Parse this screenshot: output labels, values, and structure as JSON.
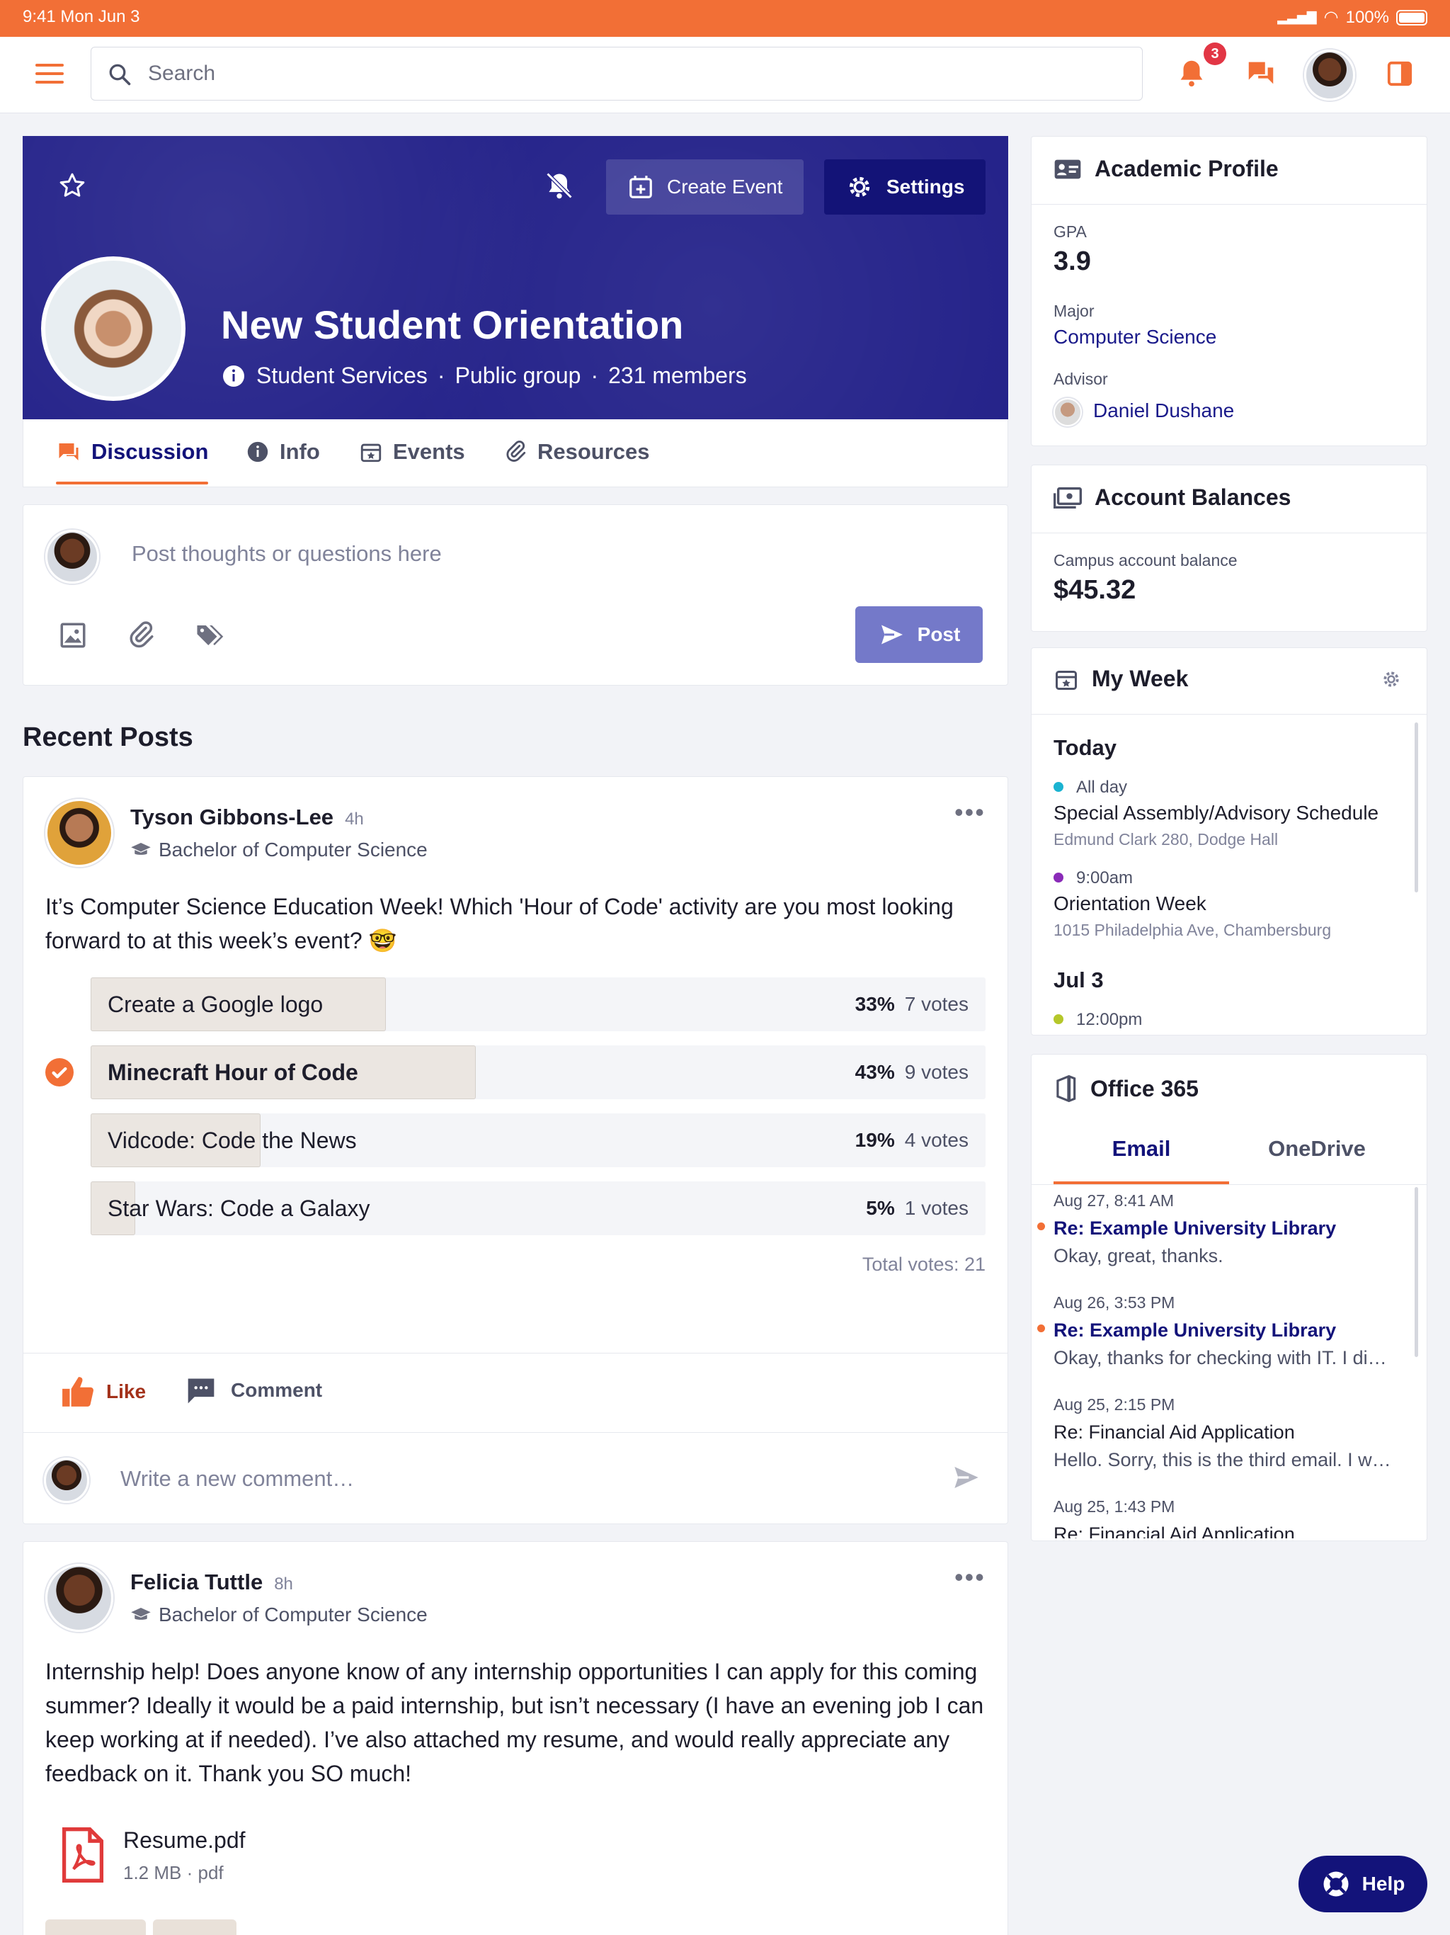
{
  "status": {
    "time": "9:41  Mon Jun 3",
    "battery": "100%"
  },
  "topbar": {
    "search_placeholder": "Search",
    "notification_count": "3"
  },
  "group": {
    "title": "New Student Orientation",
    "org": "Student Services",
    "privacy": "Public group",
    "members": "231 members",
    "create_event": "Create Event",
    "settings": "Settings"
  },
  "tabs": [
    "Discussion",
    "Info",
    "Events",
    "Resources"
  ],
  "composer": {
    "placeholder": "Post thoughts or questions here",
    "post_label": "Post"
  },
  "recent_posts_title": "Recent Posts",
  "post1": {
    "author": "Tyson Gibbons-Lee",
    "time": "4h",
    "program": "Bachelor of Computer Science",
    "body": "It’s Computer Science Education Week! Which 'Hour of Code' activity are you most looking forward to at this week’s event? 🤓",
    "poll": [
      {
        "label": "Create a Google logo",
        "percent": "33%",
        "votes": "7 votes",
        "fraction": 0.33,
        "selected": false
      },
      {
        "label": "Minecraft Hour of Code",
        "percent": "43%",
        "votes": "9 votes",
        "fraction": 0.43,
        "selected": true
      },
      {
        "label": "Vidcode: Code the News",
        "percent": "19%",
        "votes": "4 votes",
        "fraction": 0.19,
        "selected": false
      },
      {
        "label": "Star Wars: Code a Galaxy",
        "percent": "5%",
        "votes": "1 votes",
        "fraction": 0.05,
        "selected": false
      }
    ],
    "total_votes": "Total votes: 21",
    "like": "Like",
    "comment": "Comment",
    "comment_placeholder": "Write a new comment…"
  },
  "post2": {
    "author": "Felicia Tuttle",
    "time": "8h",
    "program": "Bachelor of Computer Science",
    "body": "Internship help! Does anyone know of any internship opportunities I can apply for this coming summer? Ideally it would be a paid internship, but isn’t necessary (I have an evening job I can keep working at if needed). I’ve also attached my resume, and would really appreciate any feedback on it. Thank you SO much!",
    "file_name": "Resume.pdf",
    "file_size": "1.2 MB",
    "file_type": "pdf"
  },
  "academic": {
    "title": "Academic Profile",
    "gpa_label": "GPA",
    "gpa": "3.9",
    "major_label": "Major",
    "major": "Computer Science",
    "advisor_label": "Advisor",
    "advisor": "Daniel Dushane"
  },
  "balances": {
    "title": "Account Balances",
    "label": "Campus account balance",
    "amount": "$45.32"
  },
  "week": {
    "title": "My Week",
    "today": "Today",
    "events": [
      {
        "time": "All day",
        "title": "Special Assembly/Advisory Schedule",
        "location": "Edmund Clark 280, Dodge Hall",
        "color": "#1bb3d1"
      },
      {
        "time": "9:00am",
        "title": "Orientation Week",
        "location": "1015 Philadelphia Ave, Chambersburg",
        "color": "#8a2bb8"
      }
    ],
    "next_day": "Jul 3",
    "next_event": {
      "time": "12:00pm",
      "color": "#b5c72a"
    }
  },
  "office": {
    "title": "Office 365",
    "tab_email": "Email",
    "tab_onedrive": "OneDrive",
    "emails": [
      {
        "date": "Aug 27, 8:41 AM",
        "subject": "Re: Example University Library",
        "preview": "Okay, great, thanks.",
        "unread": true
      },
      {
        "date": "Aug 26, 3:53 PM",
        "subject": "Re: Example University Library",
        "preview": "Okay, thanks for checking with IT. I di…",
        "unread": true
      },
      {
        "date": "Aug 25, 2:15 PM",
        "subject": "Re: Financial Aid Application",
        "preview": "Hello. Sorry, this is the third email. I w…",
        "unread": false
      },
      {
        "date": "Aug 25, 1:43 PM",
        "subject": "Re: Financial Aid Application",
        "preview": "",
        "unread": false
      }
    ]
  },
  "help_label": "Help",
  "colors": {
    "accent": "#f26f36",
    "navy": "#13137a",
    "banner": "#25238a"
  }
}
